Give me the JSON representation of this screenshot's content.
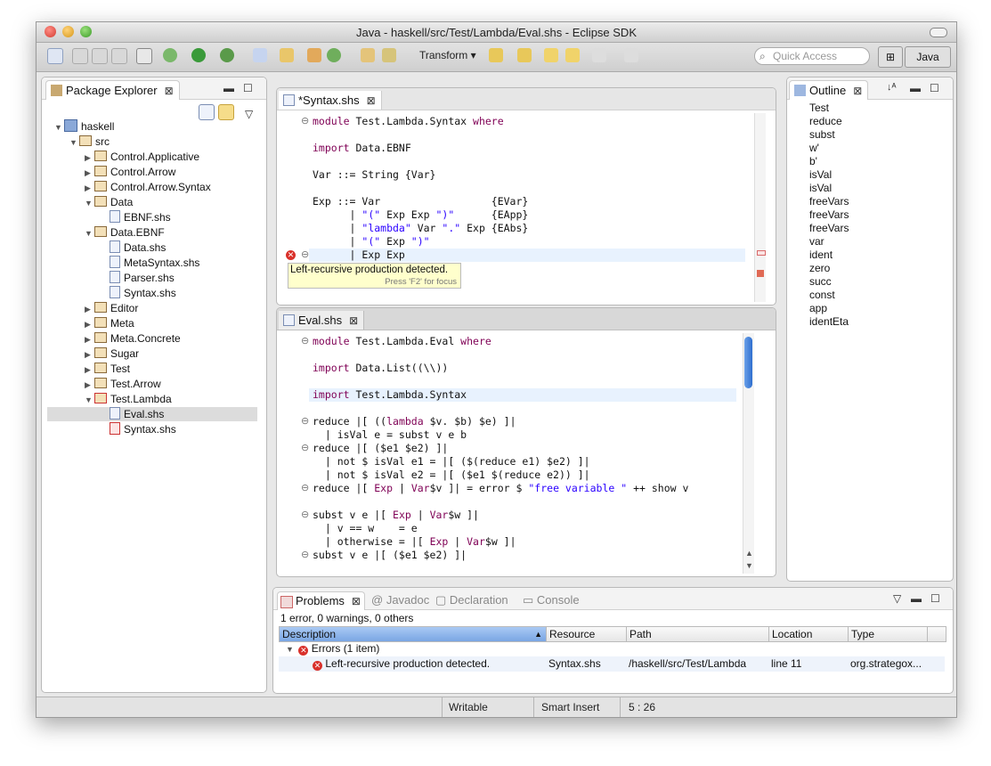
{
  "window": {
    "title": "Java - haskell/src/Test/Lambda/Eval.shs - Eclipse SDK"
  },
  "toolbar": {
    "transform_label": "Transform",
    "quick_access_placeholder": "Quick Access",
    "perspective_label": "Java"
  },
  "package_explorer": {
    "title": "Package Explorer",
    "items": [
      {
        "label": "haskell",
        "depth": 0,
        "expanded": true,
        "kind": "project"
      },
      {
        "label": "src",
        "depth": 1,
        "expanded": true,
        "kind": "srcfolder"
      },
      {
        "label": "Control.Applicative",
        "depth": 2,
        "expanded": false,
        "kind": "package"
      },
      {
        "label": "Control.Arrow",
        "depth": 2,
        "expanded": false,
        "kind": "package"
      },
      {
        "label": "Control.Arrow.Syntax",
        "depth": 2,
        "expanded": false,
        "kind": "package"
      },
      {
        "label": "Data",
        "depth": 2,
        "expanded": true,
        "kind": "package"
      },
      {
        "label": "EBNF.shs",
        "depth": 3,
        "kind": "file"
      },
      {
        "label": "Data.EBNF",
        "depth": 2,
        "expanded": true,
        "kind": "package"
      },
      {
        "label": "Data.shs",
        "depth": 3,
        "kind": "file"
      },
      {
        "label": "MetaSyntax.shs",
        "depth": 3,
        "kind": "file"
      },
      {
        "label": "Parser.shs",
        "depth": 3,
        "kind": "file"
      },
      {
        "label": "Syntax.shs",
        "depth": 3,
        "kind": "file"
      },
      {
        "label": "Editor",
        "depth": 2,
        "expanded": false,
        "kind": "package"
      },
      {
        "label": "Meta",
        "depth": 2,
        "expanded": false,
        "kind": "package"
      },
      {
        "label": "Meta.Concrete",
        "depth": 2,
        "expanded": false,
        "kind": "package"
      },
      {
        "label": "Sugar",
        "depth": 2,
        "expanded": false,
        "kind": "package"
      },
      {
        "label": "Test",
        "depth": 2,
        "expanded": false,
        "kind": "package"
      },
      {
        "label": "Test.Arrow",
        "depth": 2,
        "expanded": false,
        "kind": "package"
      },
      {
        "label": "Test.Lambda",
        "depth": 2,
        "expanded": true,
        "kind": "package-error"
      },
      {
        "label": "Eval.shs",
        "depth": 3,
        "kind": "file",
        "selected": true
      },
      {
        "label": "Syntax.shs",
        "depth": 3,
        "kind": "file-error"
      }
    ]
  },
  "syntax_editor": {
    "tab_label": "*Syntax.shs",
    "lines": [
      [
        {
          "t": "module",
          "c": "kw"
        },
        {
          "t": " Test.Lambda.Syntax "
        },
        {
          "t": "where",
          "c": "kw"
        }
      ],
      [],
      [
        {
          "t": "import",
          "c": "kw"
        },
        {
          "t": " Data.EBNF"
        }
      ],
      [],
      [
        {
          "t": "Var ::= String {Var}"
        }
      ],
      [],
      [
        {
          "t": "Exp ::= Var                  {EVar}"
        }
      ],
      [
        {
          "t": "      | "
        },
        {
          "t": "\"(\"",
          "c": "str"
        },
        {
          "t": " Exp Exp "
        },
        {
          "t": "\")\"",
          "c": "str"
        },
        {
          "t": "      {EApp}"
        }
      ],
      [
        {
          "t": "      | "
        },
        {
          "t": "\"lambda\"",
          "c": "str"
        },
        {
          "t": " Var "
        },
        {
          "t": "\".\"",
          "c": "str"
        },
        {
          "t": " Exp {EAbs}"
        }
      ],
      [
        {
          "t": "      | "
        },
        {
          "t": "\"(\"",
          "c": "str"
        },
        {
          "t": " Exp "
        },
        {
          "t": "\")\"",
          "c": "str"
        }
      ],
      [
        {
          "t": "      | Exp Exp"
        }
      ]
    ],
    "tooltip_message": "Left-recursive production detected.",
    "tooltip_hint": "Press 'F2' for focus"
  },
  "eval_editor": {
    "tab_label": "Eval.shs",
    "lines": [
      [
        {
          "t": "module",
          "c": "kw"
        },
        {
          "t": " Test.Lambda.Eval "
        },
        {
          "t": "where",
          "c": "kw"
        }
      ],
      [],
      [
        {
          "t": "import",
          "c": "kw"
        },
        {
          "t": " Data.List((\\\\))"
        }
      ],
      [],
      [
        {
          "t": "import",
          "c": "kw"
        },
        {
          "t": " Test.Lambda.Syntax"
        }
      ],
      [],
      [
        {
          "t": "reduce |[ (("
        },
        {
          "t": "lambda",
          "c": "kw"
        },
        {
          "t": " $v. $b) $e) ]|"
        }
      ],
      [
        {
          "t": "  | isVal e = subst v e b"
        }
      ],
      [
        {
          "t": "reduce |[ ($e1 $e2) ]|"
        }
      ],
      [
        {
          "t": "  | not $ isVal e1 = |[ ($(reduce e1) $e2) ]|"
        }
      ],
      [
        {
          "t": "  | not $ isVal e2 = |[ ($e1 $(reduce e2)) ]|"
        }
      ],
      [
        {
          "t": "reduce |[ "
        },
        {
          "t": "Exp",
          "c": "kw"
        },
        {
          "t": " | "
        },
        {
          "t": "Var",
          "c": "kw"
        },
        {
          "t": "$v ]| = error $ "
        },
        {
          "t": "\"free variable \"",
          "c": "str"
        },
        {
          "t": " ++ show v"
        }
      ],
      [],
      [
        {
          "t": "subst v e |[ "
        },
        {
          "t": "Exp",
          "c": "kw"
        },
        {
          "t": " | "
        },
        {
          "t": "Var",
          "c": "kw"
        },
        {
          "t": "$w ]|"
        }
      ],
      [
        {
          "t": "  | v == w    = e"
        }
      ],
      [
        {
          "t": "  | otherwise = |[ "
        },
        {
          "t": "Exp",
          "c": "kw"
        },
        {
          "t": " | "
        },
        {
          "t": "Var",
          "c": "kw"
        },
        {
          "t": "$w ]|"
        }
      ],
      [
        {
          "t": "subst v e |[ ($e1 $e2) ]|"
        }
      ]
    ]
  },
  "outline": {
    "title": "Outline",
    "items": [
      "Test",
      "reduce",
      "subst",
      "w'",
      "b'",
      "isVal",
      "isVal",
      "freeVars",
      "freeVars",
      "freeVars",
      "var",
      "ident",
      "zero",
      "succ",
      "const",
      "app",
      "identEta"
    ]
  },
  "problems": {
    "tabs": [
      "Problems",
      "Javadoc",
      "Declaration",
      "Console"
    ],
    "summary": "1 error, 0 warnings, 0 others",
    "columns": [
      "Description",
      "Resource",
      "Path",
      "Location",
      "Type"
    ],
    "group_label": "Errors (1 item)",
    "row": {
      "description": "Left-recursive production detected.",
      "resource": "Syntax.shs",
      "path": "/haskell/src/Test/Lambda",
      "location": "line 11",
      "type": "org.strategox..."
    }
  },
  "status": {
    "writable": "Writable",
    "insert_mode": "Smart Insert",
    "position": "5 : 26"
  },
  "colors": {
    "keyword": "#7f0055",
    "string": "#2a00ff",
    "current_line": "#e8f2fe",
    "error": "#d9312b"
  }
}
